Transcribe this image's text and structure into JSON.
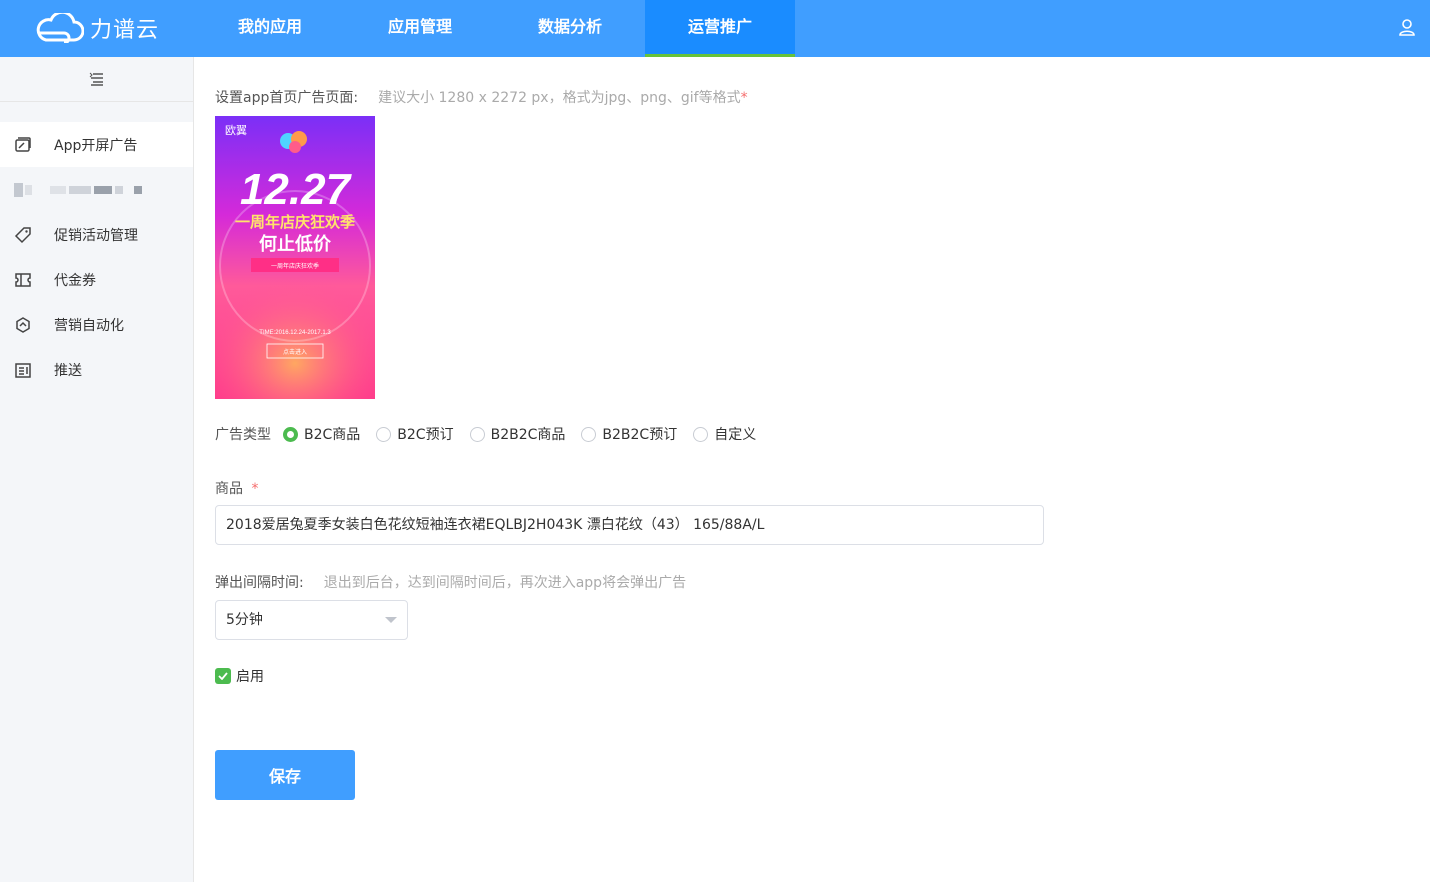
{
  "brand": {
    "name": "力谱云"
  },
  "nav": {
    "items": [
      {
        "label": "我的应用"
      },
      {
        "label": "应用管理"
      },
      {
        "label": "数据分析"
      },
      {
        "label": "运营推广"
      }
    ],
    "active_index": 3
  },
  "sidebar": {
    "items": [
      {
        "label": "App开屏广告",
        "icon": "ad-screen-icon",
        "active": true
      },
      {
        "label": "",
        "icon": "blurred-icon",
        "blurred": true
      },
      {
        "label": "促销活动管理",
        "icon": "tag-icon"
      },
      {
        "label": "代金券",
        "icon": "ticket-icon"
      },
      {
        "label": "营销自动化",
        "icon": "hexagon-icon"
      },
      {
        "label": "推送",
        "icon": "push-icon"
      }
    ]
  },
  "form": {
    "ad_page_label": "设置app首页广告页面:",
    "ad_page_hint": "建议大小 1280 x 2272 px，格式为jpg、png、gif等格式",
    "required_mark": "*",
    "ad_image": {
      "brand": "欧翼",
      "date": "12.27",
      "headline": "一周年店庆狂欢季",
      "subheadline": "何止低价",
      "ribbon": "一周年店庆狂欢季",
      "time": "TIME:2016.12.24-2017.1.3",
      "cta": "点击进入"
    },
    "ad_type_label": "广告类型",
    "ad_types": [
      "B2C商品",
      "B2C预订",
      "B2B2C商品",
      "B2B2C预订",
      "自定义"
    ],
    "ad_type_selected": 0,
    "goods_label": "商品",
    "goods_value": "2018爱居兔夏季女装白色花纹短袖连衣裙EQLBJ2H043K 漂白花纹（43） 165/88A/L",
    "interval_label": "弹出间隔时间:",
    "interval_hint": "退出到后台，达到间隔时间后，再次进入app将会弹出广告",
    "interval_value": "5分钟",
    "enable_label": "启用",
    "enable_checked": true,
    "save_label": "保存"
  },
  "colors": {
    "primary": "#409eff",
    "active_nav": "#1a8cff",
    "success": "#4cbb4f",
    "required": "#f56c6c"
  }
}
